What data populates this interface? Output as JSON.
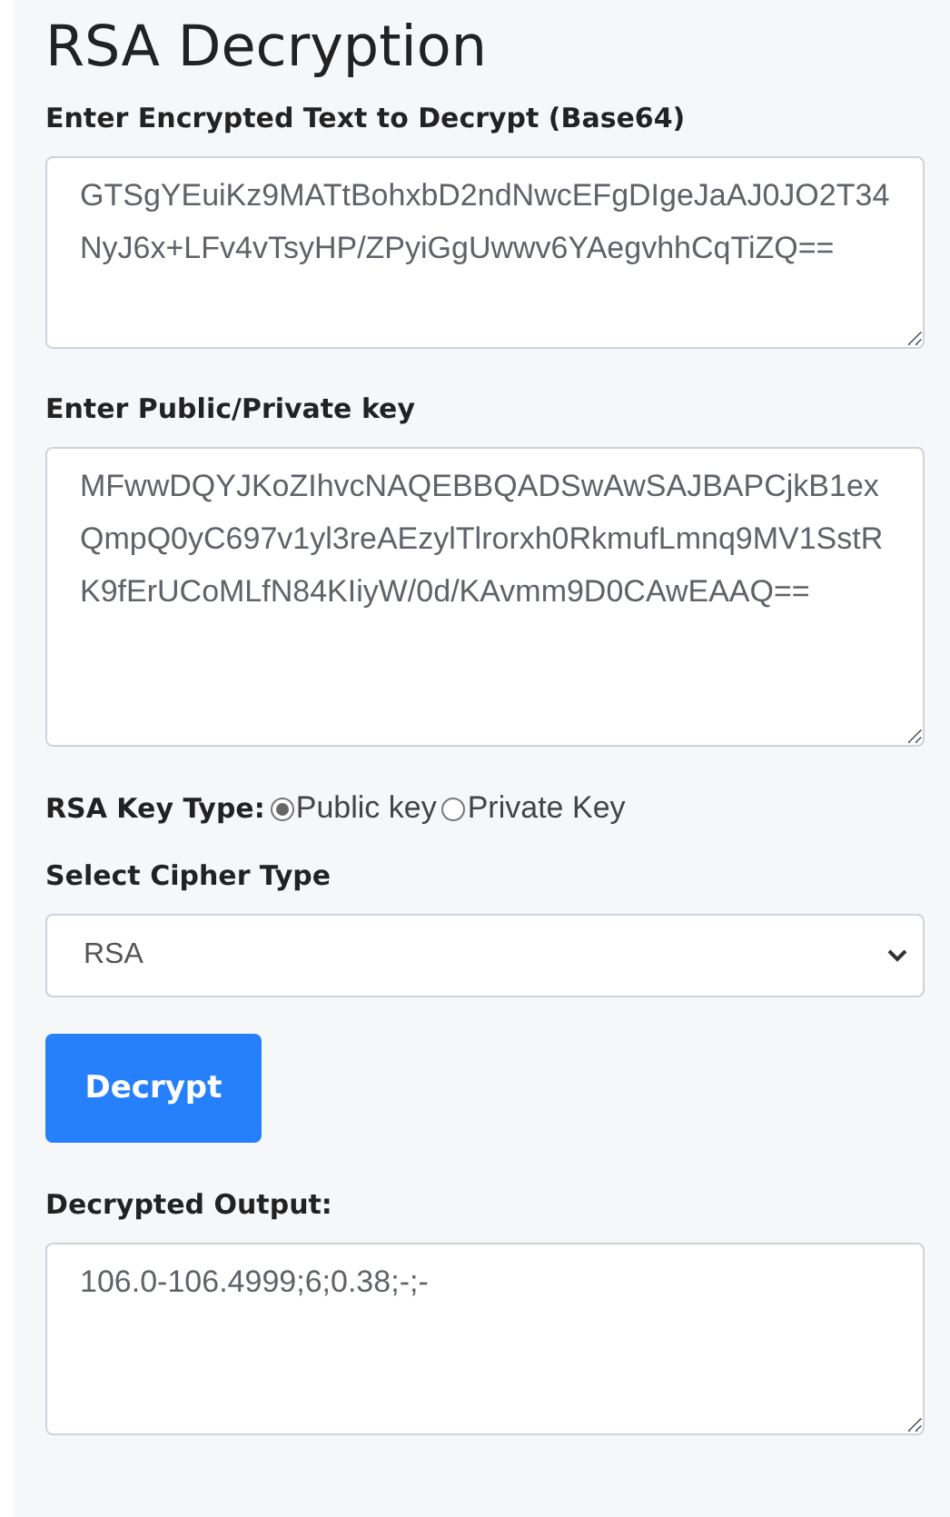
{
  "title": "RSA Decryption",
  "encrypted_field": {
    "label": "Enter Encrypted Text to Decrypt (Base64)",
    "value": "GTSgYEuiKz9MATtBohxbD2ndNwcEFgDIgeJaAJ0JO2T34NyJ6x+LFv4vTsyHP/ZPyiGgUwwv6YAegvhhCqTiZQ=="
  },
  "key_field": {
    "label": "Enter Public/Private key",
    "value": "MFwwDQYJKoZIhvcNAQEBBQADSwAwSAJBAPCjkB1exQmpQ0yC697v1yl3reAEzylTlrorxh0RkmufLmnq9MV1SstRK9fErUCoMLfN84KIiyW/0d/KAvmm9D0CAwEAAQ=="
  },
  "key_type": {
    "label": "RSA Key Type:",
    "options": [
      {
        "label": "Public key",
        "selected": true
      },
      {
        "label": "Private Key",
        "selected": false
      }
    ]
  },
  "cipher_type": {
    "label": "Select Cipher Type",
    "value": "RSA"
  },
  "decrypt_button": "Decrypt",
  "output_field": {
    "label": "Decrypted Output:",
    "value": "106.0-106.4999;6;0.38;-;-"
  }
}
